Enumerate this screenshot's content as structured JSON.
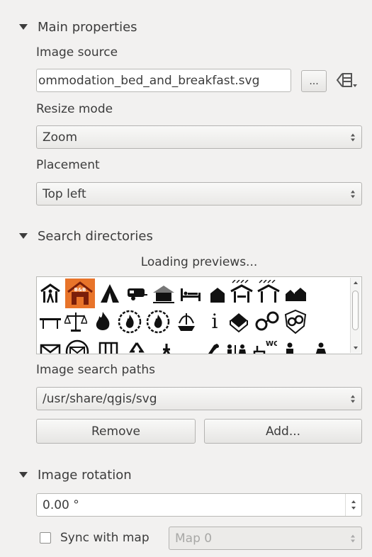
{
  "main_properties": {
    "header": "Main properties",
    "image_source_label": "Image source",
    "image_source_value": "ommodation_bed_and_breakfast.svg",
    "browse_button": "...",
    "resize_mode_label": "Resize mode",
    "resize_mode_value": "Zoom",
    "placement_label": "Placement",
    "placement_value": "Top left"
  },
  "search_directories": {
    "header": "Search directories",
    "loading_text": "Loading previews...",
    "icons": [
      "hiker-icon",
      "bed-and-breakfast-icon",
      "camping-tent-icon",
      "caravan-icon",
      "chalet-icon",
      "hostel-bed-icon",
      "house-icon",
      "shelter-rain-icon",
      "shelter-icon",
      "houses-icon",
      "picnic-bench-icon",
      "scales-justice-icon",
      "fire-icon",
      "fire-station-icon",
      "fire-station-2-icon",
      "fountain-icon",
      "information-icon",
      "library-icon",
      "handcuffs-icon",
      "police-icon",
      "mail-icon",
      "post-office-icon",
      "prison-icon",
      "recycling-icon",
      "survey-point-icon",
      "telephone-icon",
      "toilets-icon",
      "toilets-wc-icon",
      "toilets-male-icon",
      "toilets-female-icon"
    ],
    "image_search_paths_label": "Image search paths",
    "image_search_paths_value": "/usr/share/qgis/svg",
    "remove_button": "Remove",
    "add_button": "Add..."
  },
  "image_rotation": {
    "header": "Image rotation",
    "value": "0.00 °",
    "sync_label": "Sync with map",
    "sync_checked": false,
    "map_value": "Map 0"
  }
}
